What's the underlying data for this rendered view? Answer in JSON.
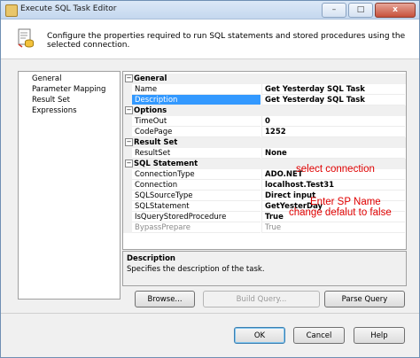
{
  "window": {
    "title": "Execute SQL Task Editor",
    "minimize_glyph": "–",
    "maximize_glyph": "□",
    "close_glyph": "x"
  },
  "header": {
    "description": "Configure the properties required to run SQL statements and stored procedures using the selected connection.",
    "icon": "sql-task-icon"
  },
  "nav": {
    "items": [
      {
        "label": "General"
      },
      {
        "label": "Parameter Mapping"
      },
      {
        "label": "Result Set"
      },
      {
        "label": "Expressions"
      }
    ]
  },
  "grid": {
    "toggle_glyph": "−",
    "categories": [
      {
        "label": "General",
        "properties": [
          {
            "name": "Name",
            "value": "Get Yesterday SQL Task"
          },
          {
            "name": "Description",
            "value": "Get Yesterday SQL Task",
            "selected": true
          }
        ]
      },
      {
        "label": "Options",
        "properties": [
          {
            "name": "TimeOut",
            "value": "0"
          },
          {
            "name": "CodePage",
            "value": "1252"
          }
        ]
      },
      {
        "label": "Result Set",
        "properties": [
          {
            "name": "ResultSet",
            "value": "None"
          }
        ]
      },
      {
        "label": "SQL Statement",
        "properties": [
          {
            "name": "ConnectionType",
            "value": "ADO.NET"
          },
          {
            "name": "Connection",
            "value": "localhost.Test31"
          },
          {
            "name": "SQLSourceType",
            "value": "Direct input"
          },
          {
            "name": "SQLStatement",
            "value": "GetYesterDay"
          },
          {
            "name": "IsQueryStoredProcedure",
            "value": "True"
          },
          {
            "name": "BypassPrepare",
            "value": "True",
            "disabled": true
          }
        ]
      }
    ]
  },
  "annotations": {
    "select_connection": "select connection",
    "enter_sp_name": "Enter SP Name",
    "change_default": "change defalut to false"
  },
  "description_panel": {
    "title": "Description",
    "text": "Specifies the description of the task."
  },
  "buttons": {
    "browse": "Browse...",
    "build_query": "Build Query...",
    "parse_query": "Parse Query",
    "ok": "OK",
    "cancel": "Cancel",
    "help": "Help"
  },
  "colors": {
    "selection": "#3399ff",
    "annotation": "#e00000"
  }
}
